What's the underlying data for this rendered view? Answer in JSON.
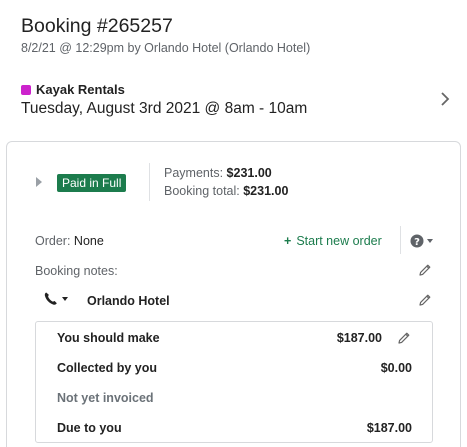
{
  "header": {
    "title": "Booking #265257",
    "subtitle": "8/2/21 @ 12:29pm by Orlando Hotel (Orlando Hotel)"
  },
  "activity": {
    "name": "Kayak Rentals",
    "datetime": "Tuesday, August 3rd 2021 @ 8am - 10am",
    "color": "#cc22cc",
    "chevron_icon": "chevron-right-icon"
  },
  "payment": {
    "status_badge": "Paid in Full",
    "payments_label": "Payments:",
    "payments_value": "$231.00",
    "total_label": "Booking total:",
    "total_value": "$231.00"
  },
  "order": {
    "label": "Order:",
    "value": "None",
    "new_order_label": "Start new order"
  },
  "notes": {
    "label": "Booking notes:"
  },
  "contact": {
    "name": "Orlando Hotel"
  },
  "summary": {
    "rows": [
      {
        "label": "You should make",
        "value": "$187.00"
      },
      {
        "label": "Collected by you",
        "value": "$0.00"
      },
      {
        "label": "Not yet invoiced",
        "value": ""
      },
      {
        "label": "Due to you",
        "value": "$187.00"
      }
    ]
  },
  "colors": {
    "accent_green": "#1c7c4d",
    "activity_magenta": "#cc22cc"
  }
}
